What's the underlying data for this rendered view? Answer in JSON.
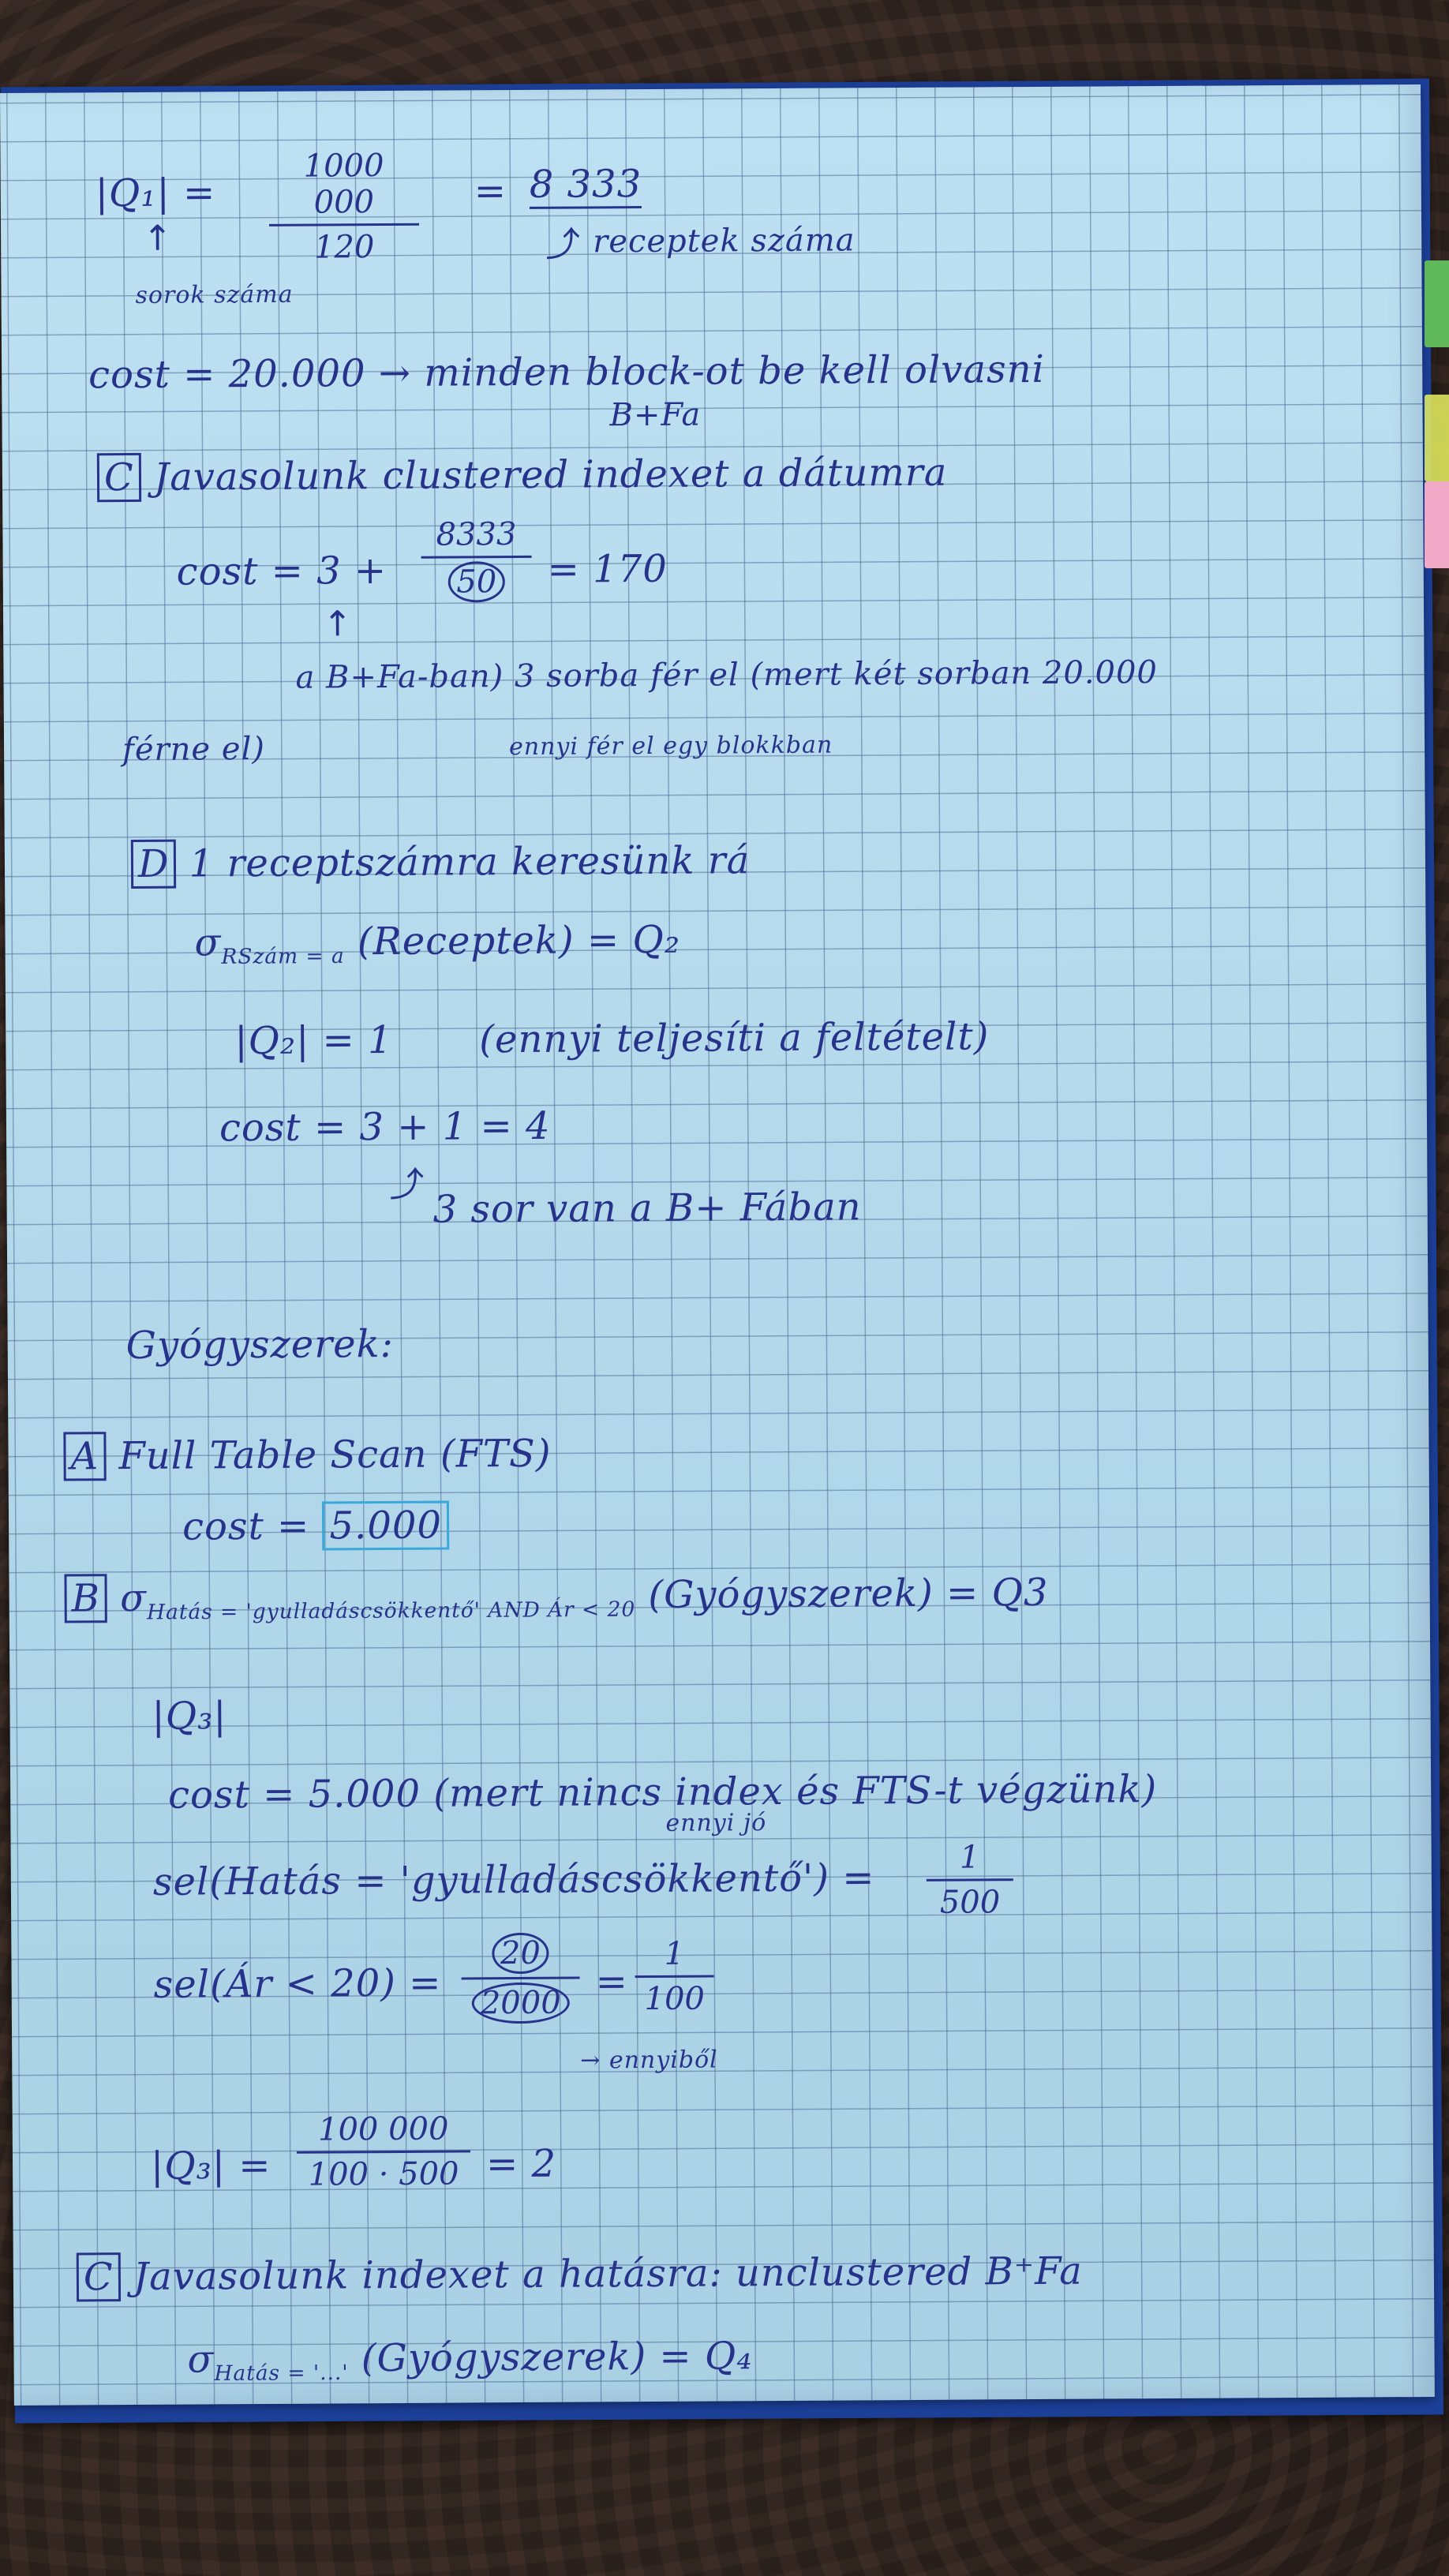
{
  "notes": {
    "q1_lhs": "|Q₁| =",
    "q1_num": "1000 000",
    "q1_den": "120",
    "q1_eq": "=",
    "q1_result": "8 333",
    "q1_result_note": "receptek száma",
    "q1_arrow_note": "sorok száma",
    "cost_line": "cost = 20.000 → minden block-ot be kell olvasni",
    "btree_note": "B+Fa",
    "c_header_label": "C",
    "c_header_text": "Javasolunk clustered indexet a dátumra",
    "c_cost_lhs": "cost = 3 +",
    "c_cost_num": "8333",
    "c_cost_den": "50",
    "c_cost_rhs": "= 170",
    "c_note1": "a B+Fa-ban) 3 sorba fér el (mert két sorban 20.000",
    "c_note2": "férne el)",
    "c_note3": "ennyi fér el egy blokkban",
    "d_header_label": "D",
    "d_header_text": "1 receptszámra keresünk rá",
    "d_sigma": "σ",
    "d_sigma_sub": "RSzám = a",
    "d_sigma_rest": "(Receptek) = Q₂",
    "d_q2": "|Q₂| = 1",
    "d_q2_note": "(ennyi teljesíti a feltételt)",
    "d_cost": "cost = 3 + 1 = 4",
    "d_cost_note": "3 sor van a B+ Fában",
    "gy_title": "Gyógyszerek:",
    "a_label": "A",
    "a_text": "Full Table Scan (FTS)",
    "a_cost_lhs": "cost =",
    "a_cost_val": "5.000",
    "b_label": "B",
    "b_sigma": "σ",
    "b_sigma_sub": "Hatás = 'gyulladáscsökkentő' AND Ár < 20",
    "b_sigma_rest": "(Gyógyszerek) = Q3",
    "b_q3": "|Q₃|",
    "b_cost": "cost = 5.000 (mert nincs index és FTS-t végzünk)",
    "b_sel1_lhs": "sel(Hatás = 'gyulladáscsökkentő') =",
    "b_sel1_num": "1",
    "b_sel1_den": "500",
    "b_sel1_note": "ennyi jó",
    "b_sel2_lhs": "sel(Ár < 20) =",
    "b_sel2_num": "20",
    "b_sel2_den": "2000",
    "b_sel2_eq": "=",
    "b_sel2_rnum": "1",
    "b_sel2_rden": "100",
    "b_sel2_note": "→ ennyiből",
    "b_q3_lhs": "|Q₃| =",
    "b_q3_num": "100 000",
    "b_q3_den": "100 · 500",
    "b_q3_rhs": "= 2",
    "c2_label": "C",
    "c2_text": "Javasolunk indexet a hatásra: unclustered B⁺Fa",
    "c2_sigma": "σ",
    "c2_sigma_sub": "Hatás = '...'",
    "c2_sigma_rest": "(Gyógyszerek) = Q₄"
  }
}
